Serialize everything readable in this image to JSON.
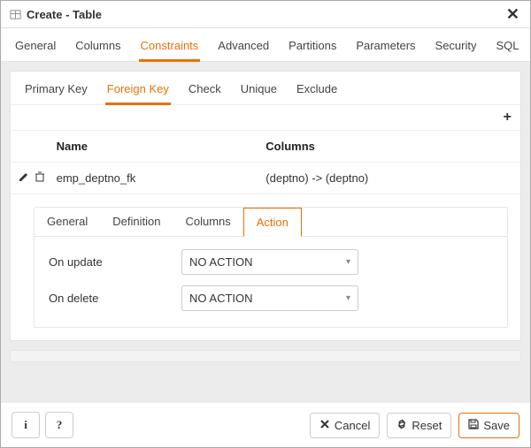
{
  "dialog": {
    "title": "Create - Table"
  },
  "mainTabs": {
    "items": [
      "General",
      "Columns",
      "Constraints",
      "Advanced",
      "Partitions",
      "Parameters",
      "Security",
      "SQL"
    ],
    "active": "Constraints"
  },
  "constraintTabs": {
    "items": [
      "Primary Key",
      "Foreign Key",
      "Check",
      "Unique",
      "Exclude"
    ],
    "active": "Foreign Key"
  },
  "fkTable": {
    "headers": {
      "name": "Name",
      "columns": "Columns"
    },
    "row": {
      "name": "emp_deptno_fk",
      "columns": "(deptno) -> (deptno)"
    }
  },
  "fkDetailTabs": {
    "items": [
      "General",
      "Definition",
      "Columns",
      "Action"
    ],
    "active": "Action"
  },
  "actionForm": {
    "onUpdate": {
      "label": "On update",
      "value": "NO ACTION"
    },
    "onDelete": {
      "label": "On delete",
      "value": "NO ACTION"
    }
  },
  "footer": {
    "info": "i",
    "help": "?",
    "cancel": "Cancel",
    "reset": "Reset",
    "save": "Save"
  }
}
